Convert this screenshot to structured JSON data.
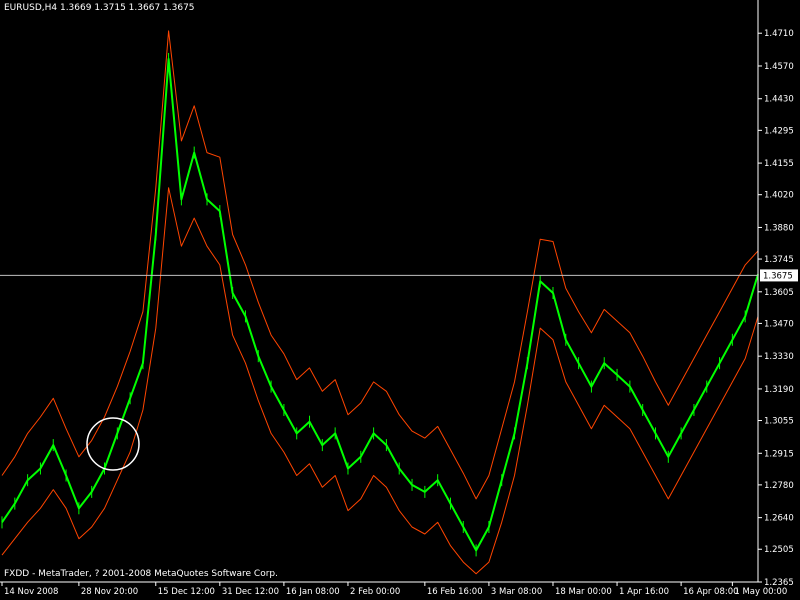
{
  "header": {
    "title": "EURUSD,H4  1.3669 1.3715 1.3667 1.3675"
  },
  "footer": {
    "copyright": "FXDD - MetaTrader, ? 2001-2008 MetaQuotes Software Corp."
  },
  "colors": {
    "background": "#000000",
    "price_line": "#00FF00",
    "envelope_lines": "#FF4500",
    "current_price_line": "#C0C0C0",
    "axis": "#FFFFFF",
    "marker_circle": "#FFFFFF"
  },
  "chart_data": {
    "type": "line",
    "symbol": "EURUSD",
    "timeframe": "H4",
    "ohlc": {
      "open": 1.3669,
      "high": 1.3715,
      "low": 1.3667,
      "close": 1.3675
    },
    "current_price": 1.3675,
    "current_price_label": "1.3675",
    "ylim": [
      1.2365,
      1.4775
    ],
    "yticks": [
      "1.4710",
      "1.4570",
      "1.4430",
      "1.4295",
      "1.4155",
      "1.4020",
      "1.3880",
      "1.3745",
      "1.3605",
      "1.3470",
      "1.3330",
      "1.3190",
      "1.3055",
      "1.2915",
      "1.2780",
      "1.2640",
      "1.2505",
      "1.2365"
    ],
    "xticks": [
      "14 Nov 2008",
      "28 Nov 20:00",
      "15 Dec 12:00",
      "31 Dec 12:00",
      "16 Jan 08:00",
      "2 Feb 00:00",
      "16 Feb 16:00",
      "3 Mar 08:00",
      "18 Mar 00:00",
      "1 Apr 16:00",
      "16 Apr 08:00",
      "1 May 00:00"
    ],
    "x_index": [
      0,
      6,
      12,
      17,
      22,
      27,
      33,
      38,
      43,
      48,
      53,
      57
    ],
    "x_count": 60,
    "series": [
      {
        "values": [
          1.262,
          1.27,
          1.28,
          1.285,
          1.295,
          1.282,
          1.268,
          1.275,
          1.285,
          1.3,
          1.315,
          1.33,
          1.385,
          1.46,
          1.4,
          1.42,
          1.4,
          1.395,
          1.36,
          1.35,
          1.333,
          1.32,
          1.31,
          1.3,
          1.305,
          1.295,
          1.3,
          1.285,
          1.29,
          1.3,
          1.295,
          1.285,
          1.278,
          1.275,
          1.28,
          1.27,
          1.26,
          1.25,
          1.26,
          1.28,
          1.3,
          1.33,
          1.365,
          1.36,
          1.34,
          1.33,
          1.32,
          1.33,
          1.325,
          1.32,
          1.31,
          1.3,
          1.29,
          1.3,
          1.31,
          1.32,
          1.33,
          1.34,
          1.35,
          1.368
        ]
      },
      {
        "values": [
          1.282,
          1.29,
          1.3,
          1.307,
          1.315,
          1.302,
          1.29,
          1.297,
          1.307,
          1.32,
          1.335,
          1.352,
          1.405,
          1.472,
          1.425,
          1.44,
          1.42,
          1.418,
          1.385,
          1.372,
          1.356,
          1.342,
          1.334,
          1.323,
          1.328,
          1.318,
          1.323,
          1.308,
          1.313,
          1.322,
          1.318,
          1.308,
          1.301,
          1.298,
          1.303,
          1.293,
          1.283,
          1.272,
          1.282,
          1.302,
          1.322,
          1.352,
          1.383,
          1.382,
          1.362,
          1.352,
          1.343,
          1.353,
          1.348,
          1.343,
          1.333,
          1.322,
          1.312,
          1.322,
          1.332,
          1.342,
          1.352,
          1.362,
          1.372,
          1.378
        ]
      },
      {
        "values": [
          1.248,
          1.255,
          1.262,
          1.268,
          1.276,
          1.268,
          1.255,
          1.26,
          1.268,
          1.28,
          1.292,
          1.31,
          1.345,
          1.405,
          1.38,
          1.392,
          1.38,
          1.372,
          1.342,
          1.33,
          1.314,
          1.3,
          1.292,
          1.282,
          1.287,
          1.277,
          1.282,
          1.267,
          1.272,
          1.282,
          1.277,
          1.267,
          1.26,
          1.257,
          1.262,
          1.252,
          1.245,
          1.24,
          1.245,
          1.262,
          1.282,
          1.312,
          1.345,
          1.34,
          1.322,
          1.312,
          1.302,
          1.312,
          1.307,
          1.302,
          1.292,
          1.282,
          1.272,
          1.282,
          1.292,
          1.302,
          1.312,
          1.322,
          1.332,
          1.35
        ]
      }
    ]
  }
}
